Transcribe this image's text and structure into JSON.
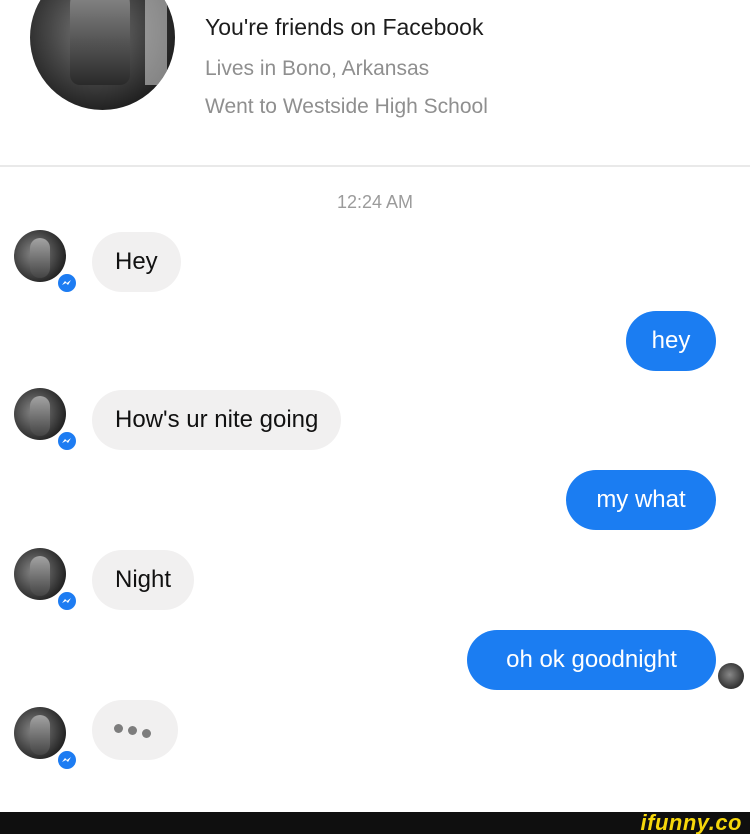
{
  "header": {
    "title": "You're friends on Facebook",
    "lives_in": "Lives in Bono, Arkansas",
    "went_to": "Went to Westside High School"
  },
  "timestamp": "12:24 AM",
  "messages": [
    {
      "from": "them",
      "text": "Hey"
    },
    {
      "from": "me",
      "text": "hey"
    },
    {
      "from": "them",
      "text": "How's ur nite going"
    },
    {
      "from": "me",
      "text": "my what"
    },
    {
      "from": "them",
      "text": "Night"
    },
    {
      "from": "me",
      "text": "oh ok goodnight"
    }
  ],
  "typing_indicator": "typing-dots",
  "footer": {
    "logo": "ifunny.co"
  },
  "colors": {
    "outgoing_bubble": "#1b7df2",
    "incoming_bubble": "#f1f0f0",
    "messenger_badge": "#1d7cf2",
    "watermark": "#f6d70b"
  }
}
